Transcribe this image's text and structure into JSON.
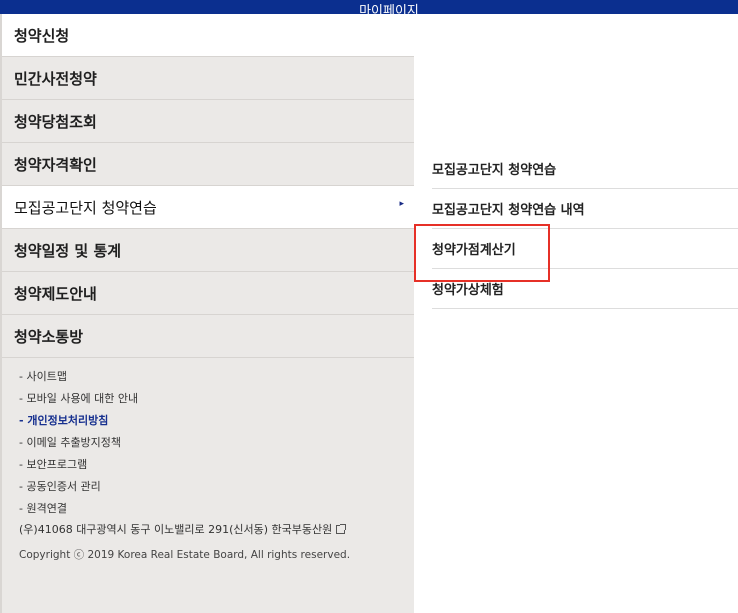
{
  "topbar": {
    "label": "마이페이지"
  },
  "menu": [
    "청약신청",
    "민간사전청약",
    "청약당첨조회",
    "청약자격확인",
    "모집공고단지 청약연습",
    "청약일정 및 통계",
    "청약제도안내",
    "청약소통방"
  ],
  "active_arrow": "▸",
  "footer": {
    "links": [
      "- 사이트맵",
      "- 모바일 사용에 대한 안내",
      "- 개인정보처리방침",
      "- 이메일 추출방지정책",
      "- 보안프로그램",
      "- 공동인증서 관리",
      "- 원격연결"
    ],
    "address": "(우)41068 대구광역시 동구 이노밸리로 291(신서동) 한국부동산원",
    "copyright": "Copyright ⓒ 2019 Korea Real Estate Board, All rights reserved."
  },
  "submenu": [
    "모집공고단지 청약연습",
    "모집공고단지 청약연습 내역",
    "청약가점계산기",
    "청약가상체험"
  ]
}
